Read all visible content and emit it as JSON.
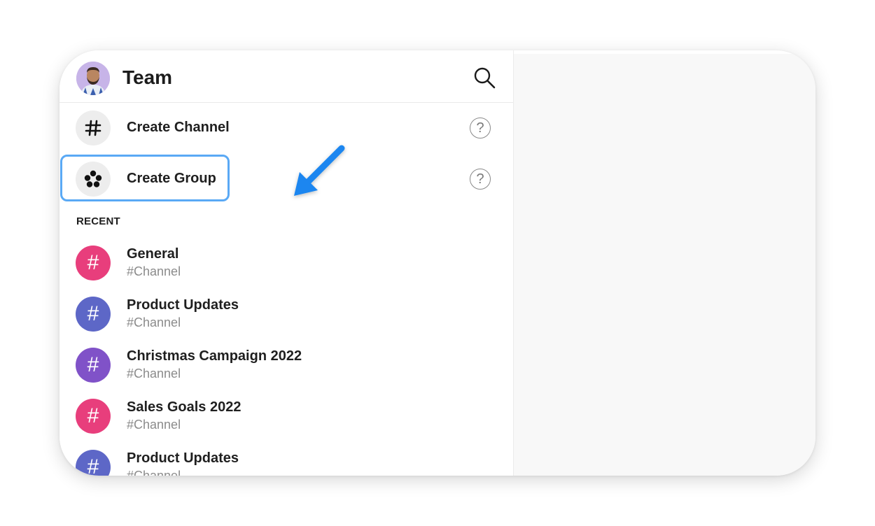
{
  "header": {
    "title": "Team"
  },
  "actions": [
    {
      "label": "Create Channel",
      "help": "?"
    },
    {
      "label": "Create Group",
      "help": "?"
    }
  ],
  "recent": {
    "label": "RECENT",
    "items": [
      {
        "name": "General",
        "sub": "#Channel",
        "icon": "#",
        "color": "#e83e7c"
      },
      {
        "name": "Product Updates",
        "sub": "#Channel",
        "icon": "#",
        "color": "#5d67c7"
      },
      {
        "name": "Christmas Campaign 2022",
        "sub": "#Channel",
        "icon": "#",
        "color": "#8052c8"
      },
      {
        "name": "Sales Goals 2022",
        "sub": "#Channel",
        "icon": "#",
        "color": "#e83e7c"
      },
      {
        "name": "Product Updates",
        "sub": "#Channel",
        "icon": "#",
        "color": "#5d67c7"
      }
    ]
  },
  "colors": {
    "highlight": "#5aa9f5",
    "arrow": "#1a86f0"
  }
}
